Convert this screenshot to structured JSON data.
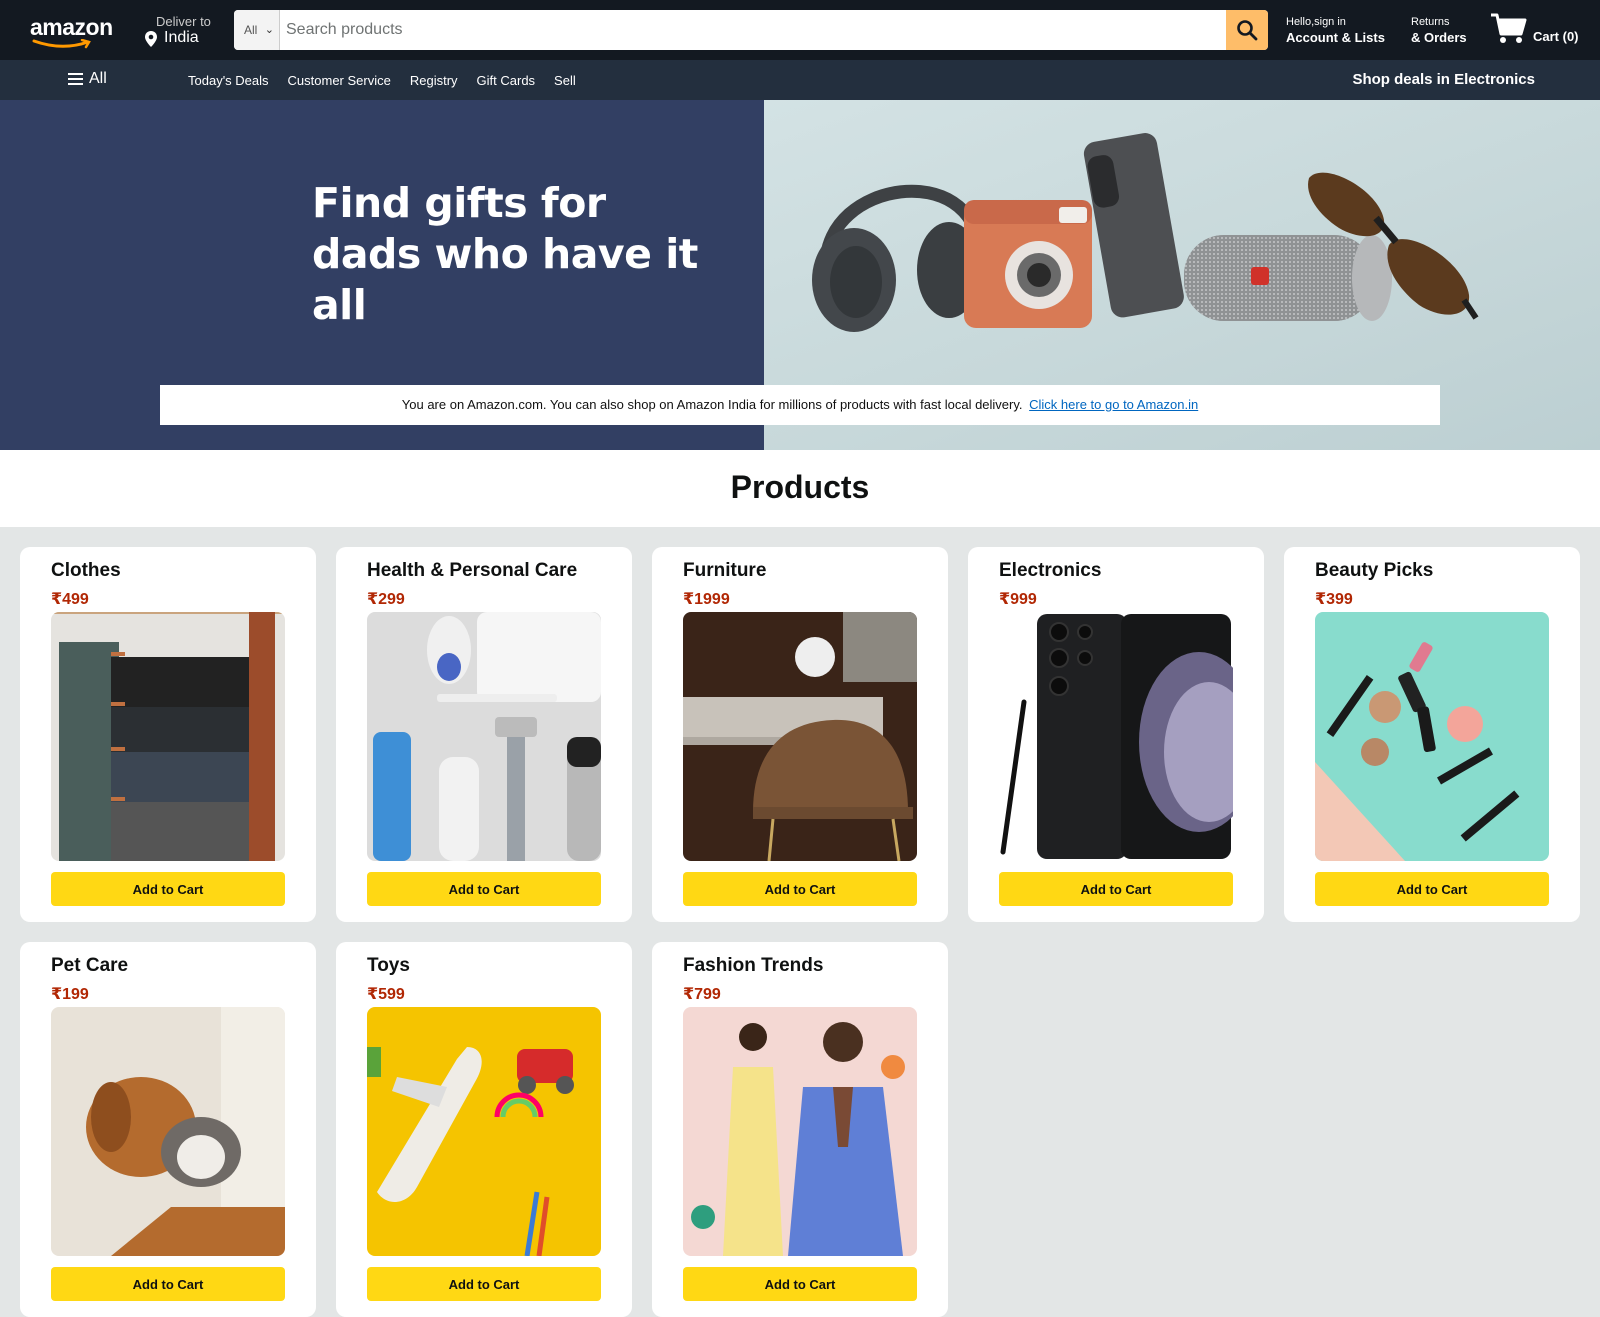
{
  "header": {
    "logo": "amazon",
    "deliver_label": "Deliver to",
    "deliver_location": "India",
    "search_category": "All",
    "search_placeholder": "Search products",
    "account_greeting": "Hello,sign in",
    "account_label": "Account & Lists",
    "returns_label": "Returns",
    "orders_label": "& Orders",
    "cart_label": "Cart (0)"
  },
  "subnav": {
    "all_label": "All",
    "links": [
      "Today's Deals",
      "Customer Service",
      "Registry",
      "Gift Cards",
      "Sell"
    ],
    "promo": "Shop deals in Electronics"
  },
  "hero": {
    "title_line1": "Find gifts for",
    "title_line2": "dads who have it all",
    "notice_text": "You are on Amazon.com. You can also shop on Amazon India for millions of products with fast local delivery.",
    "notice_link": "Click here to go to Amazon.in"
  },
  "products_heading": "Products",
  "products": [
    {
      "title": "Clothes",
      "price": "₹499",
      "button": "Add to Cart"
    },
    {
      "title": "Health & Personal Care",
      "price": "₹299",
      "button": "Add to Cart"
    },
    {
      "title": "Furniture",
      "price": "₹1999",
      "button": "Add to Cart"
    },
    {
      "title": "Electronics",
      "price": "₹999",
      "button": "Add to Cart"
    },
    {
      "title": "Beauty Picks",
      "price": "₹399",
      "button": "Add to Cart"
    },
    {
      "title": "Pet Care",
      "price": "₹199",
      "button": "Add to Cart"
    },
    {
      "title": "Toys",
      "price": "₹599",
      "button": "Add to Cart"
    },
    {
      "title": "Fashion Trends",
      "price": "₹799",
      "button": "Add to Cart"
    }
  ],
  "colors": {
    "nav_bg": "#131921",
    "subnav_bg": "#232f3e",
    "hero_bg": "#323f63",
    "search_button": "#febd69",
    "add_button": "#ffd814",
    "price": "#b12704",
    "link": "#0066c0"
  }
}
